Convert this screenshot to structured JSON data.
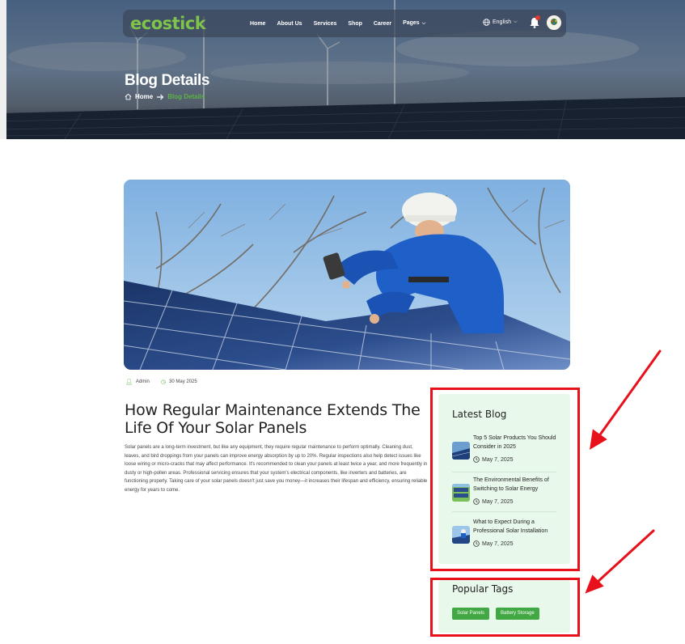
{
  "header": {
    "logo": "ecostick",
    "nav": [
      {
        "label": "Home"
      },
      {
        "label": "About Us"
      },
      {
        "label": "Services"
      },
      {
        "label": "Shop"
      },
      {
        "label": "Career"
      },
      {
        "label": "Pages"
      }
    ],
    "language": "English",
    "title": "Blog Details",
    "breadcrumb": {
      "home": "Home",
      "current": "Blog Details"
    }
  },
  "post": {
    "author": "Admin",
    "date": "30 May 2025",
    "title": "How Regular Maintenance Extends The Life Of Your Solar Panels",
    "body": "Solar panels are a long-term investment, but like any equipment, they require regular maintenance to perform optimally. Cleaning dust, leaves, and bird droppings from your panels can improve energy absorption by up to 20%. Regular inspections also help detect issues like loose wiring or micro-cracks that may affect performance. It's recommended to clean your panels at least twice a year, and more frequently in dusty or high-pollen areas. Professional servicing ensures that your system's electrical components, like inverters and batteries, are functioning properly. Taking care of your solar panels doesn't just save you money—it increases their lifespan and efficiency, ensuring reliable energy for years to come."
  },
  "sidebar": {
    "latest_title": "Latest Blog",
    "latest": [
      {
        "title": "Top 5 Solar Products You Should Consider in 2025",
        "date": "May 7, 2025"
      },
      {
        "title": "The Environmental Benefits of Switching to Solar Energy",
        "date": "May 7, 2025"
      },
      {
        "title": "What to Expect During a Professional Solar Installation",
        "date": "May 7, 2025"
      }
    ],
    "tags_title": "Popular Tags",
    "tags": [
      "Solar Panels",
      "Battery Storage"
    ]
  },
  "colors": {
    "accent": "#5fb346",
    "annotation": "#e8101a",
    "sidebar_bg": "#e8f8ea"
  }
}
